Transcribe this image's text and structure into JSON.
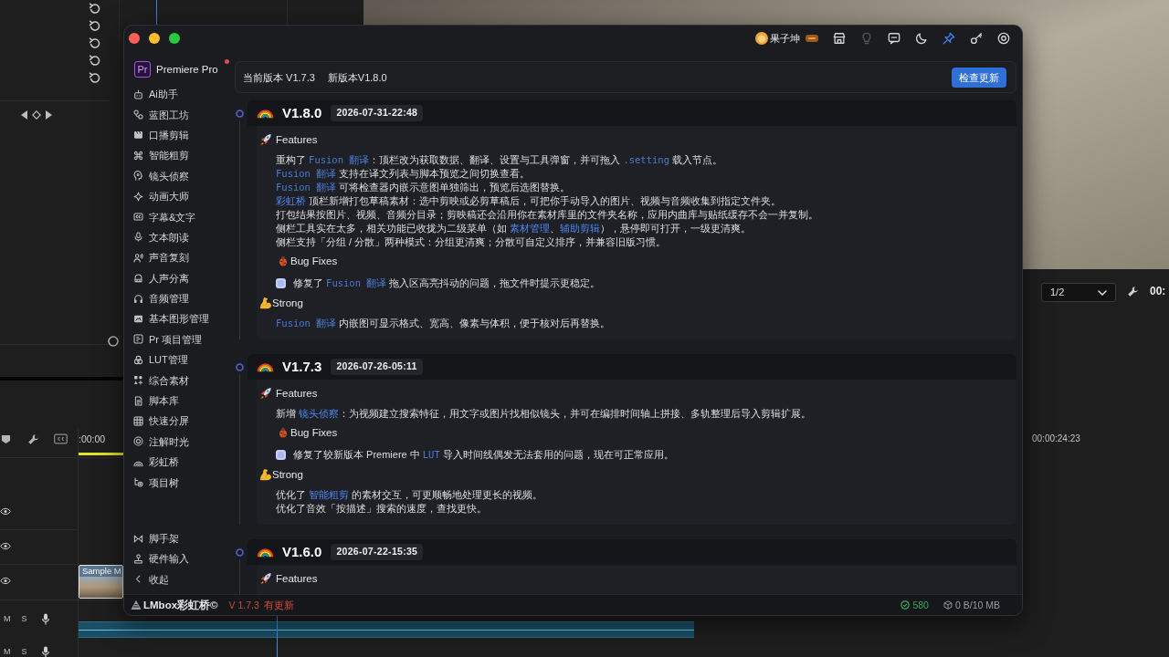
{
  "background": {
    "monitor": {
      "page": "1/2",
      "timecode": "00:"
    },
    "timeline": {
      "start_time": ":00:00",
      "end_time": "00:00:24:23",
      "clip_name": "Sample M",
      "audio_tracks": [
        {
          "mute": "M",
          "solo": "S"
        },
        {
          "mute": "M",
          "solo": "S"
        }
      ]
    }
  },
  "window": {
    "user_name": "果子坤",
    "toolbar": [
      {
        "kind": "store",
        "active": false,
        "disabled": false
      },
      {
        "kind": "bulb",
        "active": false,
        "disabled": true
      },
      {
        "kind": "chat",
        "active": false,
        "disabled": false
      },
      {
        "kind": "moon",
        "active": false,
        "disabled": false
      },
      {
        "kind": "pin",
        "active": true,
        "disabled": false
      },
      {
        "kind": "key",
        "active": false,
        "disabled": false
      },
      {
        "kind": "settings",
        "active": false,
        "disabled": false
      }
    ]
  },
  "sidebar": {
    "logo": "Pr",
    "app_name": "Premiere Pro",
    "notification": true,
    "items": [
      {
        "label": "Ai助手"
      },
      {
        "label": "蓝图工坊"
      },
      {
        "label": "口播剪辑"
      },
      {
        "label": "智能粗剪"
      },
      {
        "label": "镜头侦察"
      },
      {
        "label": "动画大师"
      },
      {
        "label": "字幕&文字"
      },
      {
        "label": "文本朗读"
      },
      {
        "label": "声音复刻"
      },
      {
        "label": "人声分离"
      },
      {
        "label": "音频管理"
      },
      {
        "label": "基本图形管理"
      },
      {
        "label": "Pr 项目管理"
      },
      {
        "label": "LUT管理"
      },
      {
        "label": "综合素材"
      },
      {
        "label": "脚本库"
      },
      {
        "label": "快速分屏"
      },
      {
        "label": "注解时光"
      },
      {
        "label": "彩虹桥"
      },
      {
        "label": "项目树"
      }
    ],
    "footer_items": [
      {
        "label": "脚手架"
      },
      {
        "label": "硬件输入"
      },
      {
        "label": "收起"
      }
    ]
  },
  "version_bar": {
    "current": "当前版本 V1.7.3",
    "latest": "新版本V1.8.0",
    "button": "检查更新"
  },
  "releases": [
    {
      "version": "V1.8.0",
      "date": "2026-07-31-22:48",
      "sections": [
        {
          "kind": "features",
          "title": "Features",
          "lines": [
            [
              {
                "kind": "plain",
                "text": "重构了 "
              },
              {
                "kind": "code",
                "text": "Fusion 翻译"
              },
              {
                "kind": "plain",
                "text": "：顶栏改为获取数据、翻译、设置与工具弹窗，并可拖入 "
              },
              {
                "kind": "code",
                "text": ".setting"
              },
              {
                "kind": "plain",
                "text": " 载入节点。"
              }
            ],
            [
              {
                "kind": "code",
                "text": "Fusion 翻译"
              },
              {
                "kind": "plain",
                "text": " 支持在译文列表与脚本预览之间切换查看。"
              }
            ],
            [
              {
                "kind": "code",
                "text": "Fusion 翻译"
              },
              {
                "kind": "plain",
                "text": " 可将检查器内嵌示意图单独筛出，预览后选图替换。"
              }
            ],
            [
              {
                "kind": "link",
                "text": "彩虹桥"
              },
              {
                "kind": "plain",
                "text": " 顶栏新增打包草稿素材：选中剪映或必剪草稿后，可把你手动导入的图片、视频与音频收集到指定文件夹。"
              }
            ],
            [
              {
                "kind": "plain",
                "text": "打包结果按图片、视频、音频分目录；剪映稿还会沿用你在素材库里的文件夹名称，应用内曲库与贴纸缓存不会一并复制。"
              }
            ],
            [
              {
                "kind": "plain",
                "text": "侧栏工具实在太多，相关功能已收拢为二级菜单（如 "
              },
              {
                "kind": "link",
                "text": "素材管理"
              },
              {
                "kind": "plain",
                "text": "、"
              },
              {
                "kind": "link",
                "text": "辅助剪辑"
              },
              {
                "kind": "plain",
                "text": "），悬停即可打开，一级更清爽。"
              }
            ],
            [
              {
                "kind": "plain",
                "text": "侧栏支持「分组 / 分散」两种模式：分组更清爽；分散可自定义排序，并兼容旧版习惯。"
              }
            ]
          ]
        },
        {
          "kind": "bug_fixes",
          "title": "Bug Fixes",
          "lines": [
            [
              {
                "kind": "plain",
                "text": "修复了 "
              },
              {
                "kind": "code",
                "text": "Fusion 翻译"
              },
              {
                "kind": "plain",
                "text": " 拖入区高亮抖动的问题，拖文件时提示更稳定。"
              }
            ]
          ]
        },
        {
          "kind": "strong",
          "title": "Strong",
          "lines": [
            [
              {
                "kind": "code",
                "text": "Fusion 翻译"
              },
              {
                "kind": "plain",
                "text": " 内嵌图可显示格式、宽高、像素与体积，便于核对后再替换。"
              }
            ]
          ]
        }
      ]
    },
    {
      "version": "V1.7.3",
      "date": "2026-07-26-05:11",
      "sections": [
        {
          "kind": "features",
          "title": "Features",
          "lines": [
            [
              {
                "kind": "plain",
                "text": "新增 "
              },
              {
                "kind": "link",
                "text": "镜头侦察"
              },
              {
                "kind": "plain",
                "text": "：为视频建立搜索特征，用文字或图片找相似镜头，并可在编排时间轴上拼接、多轨整理后导入剪辑扩展。"
              }
            ]
          ]
        },
        {
          "kind": "bug_fixes",
          "title": "Bug Fixes",
          "lines": [
            [
              {
                "kind": "plain",
                "text": "修复了较新版本 Premiere 中 "
              },
              {
                "kind": "code",
                "text": "LUT"
              },
              {
                "kind": "plain",
                "text": " 导入时间线偶发无法套用的问题，现在可正常应用。"
              }
            ]
          ]
        },
        {
          "kind": "strong",
          "title": "Strong",
          "lines": [
            [
              {
                "kind": "plain",
                "text": "优化了 "
              },
              {
                "kind": "link",
                "text": "智能粗剪"
              },
              {
                "kind": "plain",
                "text": " 的素材交互，可更顺畅地处理更长的视频。"
              }
            ],
            [
              {
                "kind": "plain",
                "text": "优化了音效「按描述」搜索的速度，查找更快。"
              }
            ]
          ]
        }
      ]
    },
    {
      "version": "V1.6.0",
      "date": "2026-07-22-15:35",
      "sections": [
        {
          "kind": "features",
          "title": "Features"
        }
      ]
    }
  ],
  "footer": {
    "brand": "LMbox彩虹桥©",
    "version": "V 1.7.3",
    "update_notice": "有更新",
    "count": "580",
    "storage": "0 B/10 MB"
  }
}
